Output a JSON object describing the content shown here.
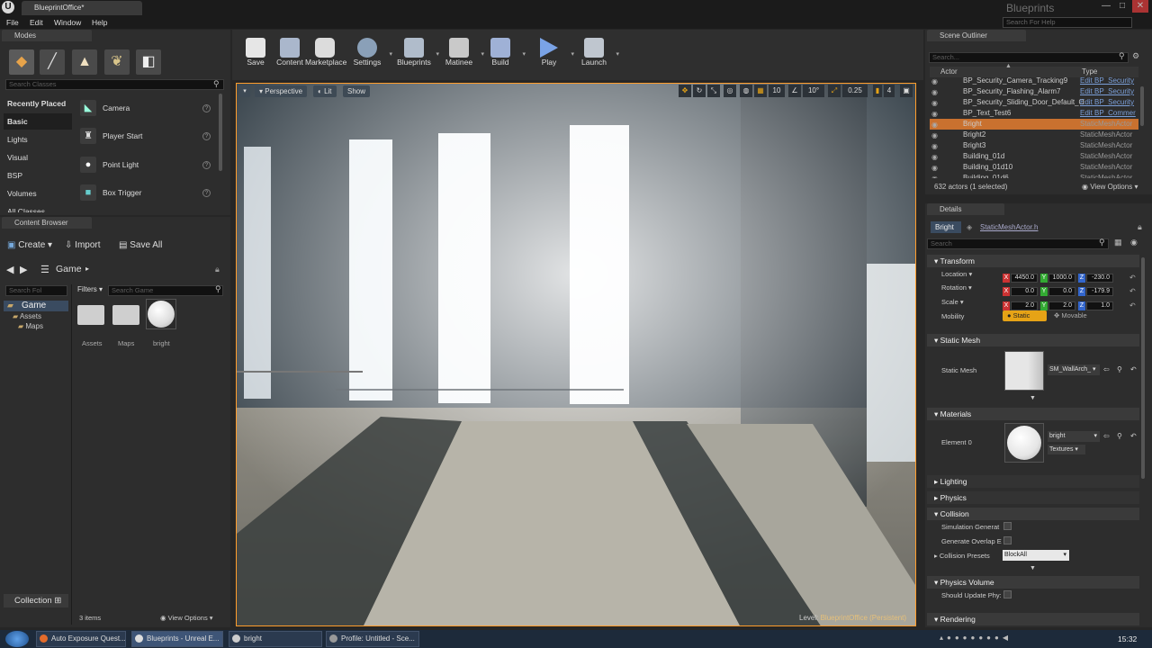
{
  "window": {
    "doc_tab": "BlueprintOffice*",
    "brand": "Blueprints",
    "help_search_placeholder": "Search For Help",
    "min": "—",
    "max": "□",
    "close": "✕"
  },
  "menu": [
    "File",
    "Edit",
    "Window",
    "Help"
  ],
  "modes": {
    "tab": "Modes",
    "search_placeholder": "Search Classes",
    "categories": [
      "Recently Placed",
      "Basic",
      "Lights",
      "Visual",
      "BSP",
      "Volumes",
      "All Classes"
    ],
    "selected_category": "Basic",
    "items": [
      {
        "label": "Camera",
        "icon": "camera-icon"
      },
      {
        "label": "Player Start",
        "icon": "player-start-icon"
      },
      {
        "label": "Point Light",
        "icon": "point-light-icon"
      },
      {
        "label": "Box Trigger",
        "icon": "box-trigger-icon"
      }
    ]
  },
  "toolbar": [
    {
      "label": "Save",
      "icon": "save-icon"
    },
    {
      "label": "Content",
      "icon": "content-icon"
    },
    {
      "label": "Marketplace",
      "icon": "marketplace-icon"
    },
    {
      "label": "Settings",
      "icon": "settings-icon"
    },
    {
      "label": "Blueprints",
      "icon": "blueprints-icon"
    },
    {
      "label": "Matinee",
      "icon": "matinee-icon"
    },
    {
      "label": "Build",
      "icon": "build-icon"
    },
    {
      "label": "Play",
      "icon": "play-icon"
    },
    {
      "label": "Launch",
      "icon": "launch-icon"
    }
  ],
  "content_browser": {
    "tab": "Content Browser",
    "create": "Create",
    "import": "Import",
    "save_all": "Save All",
    "path": "Game",
    "search_folders": "Search Fol",
    "filters": "Filters",
    "search_game": "Search Game",
    "tree": [
      "Game",
      "Assets",
      "Maps"
    ],
    "assets": [
      {
        "label": "Assets",
        "kind": "folder"
      },
      {
        "label": "Maps",
        "kind": "folder"
      },
      {
        "label": "bright",
        "kind": "material"
      }
    ],
    "collections": "Collection",
    "count": "3 items",
    "view_options": "View Options"
  },
  "viewport": {
    "perspective": "Perspective",
    "lit": "Lit",
    "show": "Show",
    "grid_snap": "10",
    "rot_snap": "10°",
    "scale_snap": "0.25",
    "camera_speed": "4",
    "level_label": "Level:",
    "level_name": "BlueprintOffice (Persistent)"
  },
  "outliner": {
    "tab": "Scene Outliner",
    "search_placeholder": "Search...",
    "col_actor": "Actor",
    "col_type": "Type",
    "rows": [
      {
        "name": "BP_Security_Camera_Tracking9",
        "type": "Edit BP_Security",
        "link": true
      },
      {
        "name": "BP_Security_Flashing_Alarm7",
        "type": "Edit BP_Security",
        "link": true
      },
      {
        "name": "BP_Security_Sliding_Door_Default_O",
        "type": "Edit BP_Security",
        "link": true
      },
      {
        "name": "BP_Text_Test6",
        "type": "Edit BP_Commer",
        "link": true
      },
      {
        "name": "Bright",
        "type": "StaticMeshActor",
        "link": false,
        "selected": true
      },
      {
        "name": "Bright2",
        "type": "StaticMeshActor",
        "link": false
      },
      {
        "name": "Bright3",
        "type": "StaticMeshActor",
        "link": false
      },
      {
        "name": "Building_01d",
        "type": "StaticMeshActor",
        "link": false
      },
      {
        "name": "Building_01d10",
        "type": "StaticMeshActor",
        "link": false
      },
      {
        "name": "Building_01d6",
        "type": "StaticMeshActor",
        "link": false
      }
    ],
    "status": "632 actors (1 selected)",
    "view_options": "View Options"
  },
  "details": {
    "tab": "Details",
    "actor_name": "Bright",
    "class_link": "StaticMeshActor.h",
    "search_placeholder": "Search",
    "transform": {
      "title": "Transform",
      "location_label": "Location",
      "rotation_label": "Rotation",
      "scale_label": "Scale",
      "mobility_label": "Mobility",
      "location": [
        "4450.0",
        "1000.0",
        "-230.0"
      ],
      "rotation": [
        "0.0",
        "0.0",
        "-179.9"
      ],
      "scale": [
        "2.0",
        "2.0",
        "1.0"
      ],
      "mobility_static": "Static",
      "mobility_movable": "Movable"
    },
    "static_mesh": {
      "title": "Static Mesh",
      "label": "Static Mesh",
      "value": "SM_WallArch_"
    },
    "materials": {
      "title": "Materials",
      "element": "Element 0",
      "value": "bright",
      "textures": "Textures"
    },
    "lighting": "Lighting",
    "physics": "Physics",
    "collision": {
      "title": "Collision",
      "sim_gen": "Simulation Generat",
      "gen_overlap": "Generate Overlap E",
      "presets_label": "Collision Presets",
      "presets_value": "BlockAll"
    },
    "physics_volume": {
      "title": "Physics Volume",
      "should_update": "Should Update Phy:"
    },
    "rendering": "Rendering"
  },
  "taskbar": {
    "items": [
      "Auto Exposure Quest...",
      "Blueprints - Unreal E...",
      "bright",
      "Profile: Untitled - Sce..."
    ],
    "clock": "15:32"
  },
  "colors": {
    "selection": "#c9712f",
    "link": "#7b9fd8",
    "static_btn": "#e6a316",
    "viewport_border": "#ff9d2b"
  }
}
